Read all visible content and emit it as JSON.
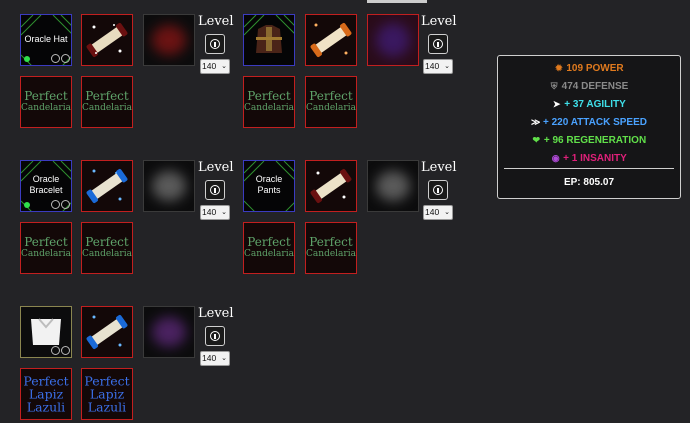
{
  "level_label": "Level",
  "level_value": "140",
  "equipment": {
    "oracle_hat": "Oracle Hat",
    "oracle_bracelet_line1": "Oracle",
    "oracle_bracelet_line2": "Bracelet",
    "oracle_pants": "Oracle Pants"
  },
  "gems": {
    "perfect": "Perfect",
    "candelaria": "Candelaria",
    "lapiz": "Lapiz",
    "lazuli": "Lazuli"
  },
  "stats": {
    "power": "109 POWER",
    "defense": "474 DEFENSE",
    "agility": "+ 37 AGILITY",
    "attack_speed": "+ 220 ATTACK SPEED",
    "regeneration": "+ 96 REGENERATION",
    "insanity": "+ 1 INSANITY",
    "ep": "EP: 805.07"
  },
  "colors": {
    "power": "#e07a1e",
    "defense": "#8a8a8a",
    "agility": "#3fe0ea",
    "attack_speed": "#4aa2ff",
    "regeneration": "#61e04a",
    "insanity": "#e0207a"
  }
}
